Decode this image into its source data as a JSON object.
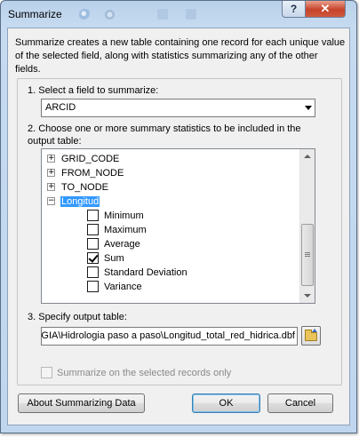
{
  "window": {
    "title": "Summarize",
    "help_label": "?",
    "close_label": "✕"
  },
  "description": "Summarize creates a new table containing one record for each unique value of the selected field, along with statistics summarizing any of the other fields.",
  "step1": {
    "label": "1.  Select a field to summarize:",
    "selected_field": "ARCID"
  },
  "step2": {
    "label": "2.  Choose one or more summary statistics to be included in the output table:",
    "fields": [
      {
        "name": "GRID_CODE",
        "expander": "+"
      },
      {
        "name": "FROM_NODE",
        "expander": "+"
      },
      {
        "name": "TO_NODE",
        "expander": "+"
      },
      {
        "name": "Longitud",
        "expander": "−"
      }
    ],
    "statistics": [
      {
        "name": "Minimum",
        "checked": false
      },
      {
        "name": "Maximum",
        "checked": false
      },
      {
        "name": "Average",
        "checked": false
      },
      {
        "name": "Sum",
        "checked": true
      },
      {
        "name": "Standard Deviation",
        "checked": false
      },
      {
        "name": "Variance",
        "checked": false
      }
    ]
  },
  "step3": {
    "label": "3.  Specify output table:",
    "output_path": "GIA\\Hidrologia paso a paso\\Longitud_total_red_hidrica.dbf"
  },
  "selected_only": {
    "label": "Summarize on the selected records only",
    "checked": false,
    "enabled": false
  },
  "buttons": {
    "about": "About Summarizing Data",
    "ok": "OK",
    "cancel": "Cancel"
  }
}
